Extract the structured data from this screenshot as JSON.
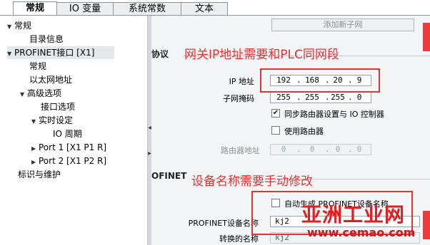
{
  "tabs": [
    {
      "label": "常规",
      "active": true
    },
    {
      "label": "IO 变量",
      "active": false
    },
    {
      "label": "系统常数",
      "active": false
    },
    {
      "label": "文本",
      "active": false
    }
  ],
  "tree": [
    {
      "label": "常规",
      "expanded": true
    },
    {
      "label": "目录信息"
    },
    {
      "label": "PROFINET接口 [X1]",
      "expanded": true
    },
    {
      "label": "常规"
    },
    {
      "label": "以太网地址"
    },
    {
      "label": "高级选项",
      "expanded": true
    },
    {
      "label": "接口选项"
    },
    {
      "label": "实时设定",
      "expanded": true
    },
    {
      "label": "IO 周期"
    },
    {
      "label": "Port 1 [X1 P1 R]",
      "expanded": false
    },
    {
      "label": "Port 2 [X1 P2 R]",
      "expanded": false
    },
    {
      "label": "标识与维护"
    }
  ],
  "form": {
    "add_subnet_button": "添加新子网",
    "protocol_section_tail": "协议",
    "ip_label": "IP 地址",
    "ip": [
      "192",
      "168",
      "20",
      "9"
    ],
    "mask_label": "子网掩码",
    "mask": [
      "255",
      "255",
      "255",
      "0"
    ],
    "sync_router_label": "同步路由器设置与 IO 控制器",
    "sync_router_checked": true,
    "use_router_label": "使用路由器",
    "use_router_checked": false,
    "router_label": "路由器地址",
    "router": [
      "0",
      "0",
      "0",
      "0"
    ],
    "profinet_section_tail": "OFINET",
    "auto_name_label": "自动生成 PROFINET设备名称",
    "auto_name_checked": false,
    "device_name_label": "PROFINET设备名称",
    "device_name": "kj2",
    "converted_label": "转换的名称",
    "converted_name": "kj2"
  },
  "annotations": {
    "ip_note": "网关IP地址需要和PLC同网段",
    "name_note": "设备名称需要手动修改"
  },
  "watermark": {
    "main": "亚洲工业网",
    "url": "www.cemao.com"
  },
  "colors": {
    "annotation": "#e53333",
    "selected_tab_bg": "#ffffff",
    "panel_bg": "#f3f5f7"
  }
}
